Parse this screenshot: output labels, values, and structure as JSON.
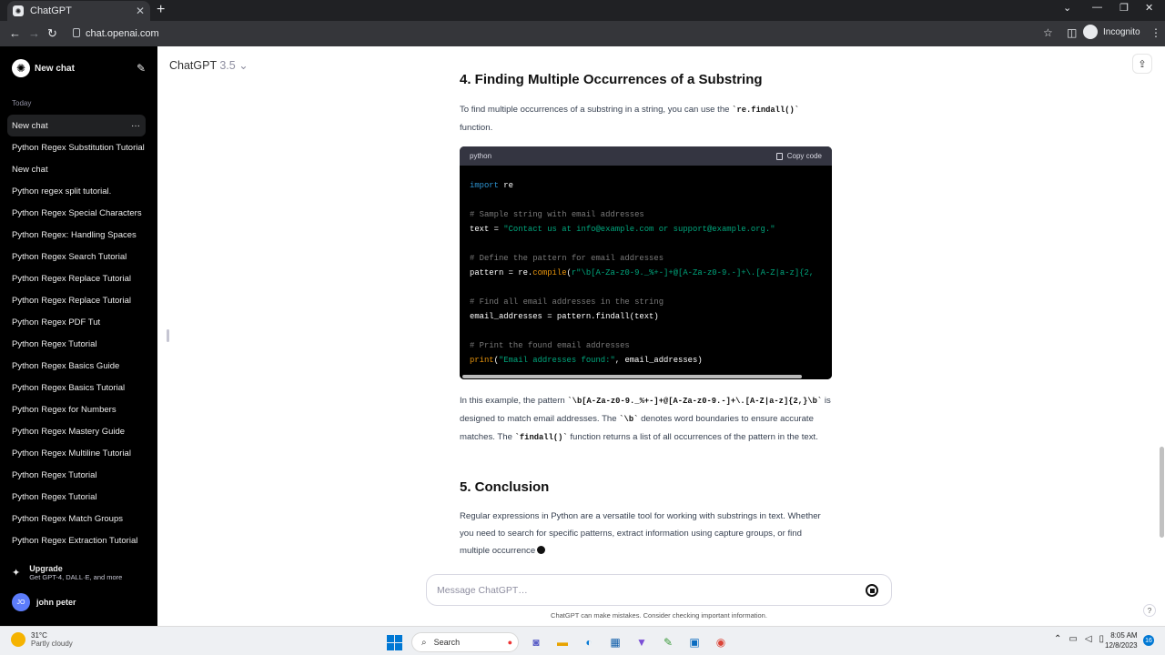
{
  "browser": {
    "tab_title": "ChatGPT",
    "url": "chat.openai.com",
    "incognito_label": "Incognito"
  },
  "sidebar": {
    "new_chat_label": "New chat",
    "section_label": "Today",
    "items": [
      {
        "label": "New chat",
        "active": true
      },
      {
        "label": "Python Regex Substitution Tutorial"
      },
      {
        "label": "New chat"
      },
      {
        "label": "Python regex split tutorial."
      },
      {
        "label": "Python Regex Special Characters"
      },
      {
        "label": "Python Regex: Handling Spaces"
      },
      {
        "label": "Python Regex Search Tutorial"
      },
      {
        "label": "Python Regex Replace Tutorial"
      },
      {
        "label": "Python Regex Replace Tutorial"
      },
      {
        "label": "Python Regex PDF Tut"
      },
      {
        "label": "Python Regex Tutorial"
      },
      {
        "label": "Python Regex Basics Guide"
      },
      {
        "label": "Python Regex Basics Tutorial"
      },
      {
        "label": "Python Regex for Numbers"
      },
      {
        "label": "Python Regex Mastery Guide"
      },
      {
        "label": "Python Regex Multiline Tutorial"
      },
      {
        "label": "Python Regex Tutorial"
      },
      {
        "label": "Python Regex Tutorial"
      },
      {
        "label": "Python Regex Match Groups"
      },
      {
        "label": "Python Regex Extraction Tutorial"
      }
    ],
    "upgrade_title": "Upgrade",
    "upgrade_sub": "Get GPT-4, DALL·E, and more",
    "user_initials": "JO",
    "user_name": "john peter"
  },
  "header": {
    "model_name": "ChatGPT",
    "model_version": "3.5"
  },
  "content": {
    "h4": "4. Finding Multiple Occurrences of a Substring",
    "p1_text": "To find multiple occurrences of a substring in a string, you can use the ",
    "p1_code": "`re.findall()`",
    "p1_tail": " function.",
    "code_lang": "python",
    "copy_label": "Copy code",
    "code": {
      "l1_kw": "import",
      "l1_rest": " re",
      "l2": "# Sample string with email addresses",
      "l3_a": "text = ",
      "l3_str": "\"Contact us at info@example.com or support@example.org.\"",
      "l4": "# Define the pattern for email addresses",
      "l5_a": "pattern = re.",
      "l5_fn": "compile",
      "l5_b": "(",
      "l5_str": "r\"\\b[A-Za-z0-9._%+-]+@[A-Za-z0-9.-]+\\.[A-Z|a-z]{2,",
      "l6": "# Find all email addresses in the string",
      "l7": "email_addresses = pattern.findall(text)",
      "l8": "# Print the found email addresses",
      "l9_fn": "print",
      "l9_b": "(",
      "l9_str": "\"Email addresses found:\"",
      "l9_rest": ", email_addresses)"
    },
    "p2_a": "In this example, the pattern ",
    "p2_code1": "`\\b[A-Za-z0-9._%+-]+@[A-Za-z0-9.-]+\\.[A-Z|a-z]{2,}\\b`",
    "p2_b": " is designed to match email addresses. The ",
    "p2_code2": "`\\b`",
    "p2_c": " denotes word boundaries to ensure accurate matches. The ",
    "p2_code3": "`findall()`",
    "p2_d": " function returns a list of all occurrences of the pattern in the text.",
    "h5": "5. Conclusion",
    "p3": "Regular expressions in Python are a versatile tool for working with substrings in text. Whether you need to search for specific patterns, extract information using capture groups, or find multiple occurrence"
  },
  "composer": {
    "placeholder": "Message ChatGPT…",
    "disclaimer": "ChatGPT can make mistakes. Consider checking important information."
  },
  "taskbar": {
    "temp": "31°C",
    "weather": "Partly cloudy",
    "search_label": "Search",
    "time": "8:05 AM",
    "date": "12/8/2023",
    "notif_count": "16"
  }
}
